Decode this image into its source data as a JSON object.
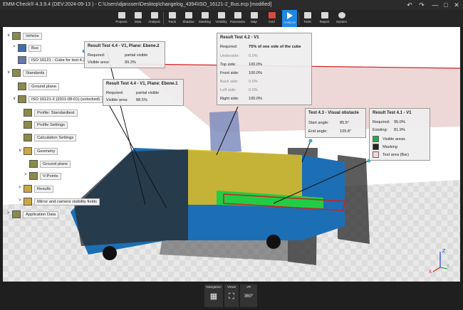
{
  "titlebar": {
    "title": "EMM-Check® 4.3.9.4 (DEV:2024-09-13 )  - C:\\Users\\djanssen\\Desktop\\changelog_4394\\ISO_16121-2_Bus.ecp [modified]",
    "undo_icon": "undo-icon",
    "redo_icon": "redo-icon",
    "minimize": "—",
    "maximize": "□",
    "close": "✕"
  },
  "ribbon": {
    "buttons": [
      {
        "label": "Projects",
        "icon": "projects-icon"
      },
      {
        "label": "Data",
        "icon": "data-icon"
      },
      {
        "label": "Analysis",
        "icon": "analysis-icon"
      },
      {
        "label": "Track",
        "icon": "track-icon"
      },
      {
        "label": "Shadow",
        "icon": "shadow-icon"
      },
      {
        "label": "Masking",
        "icon": "masking-icon"
      },
      {
        "label": "Visibility",
        "icon": "visibility-icon"
      },
      {
        "label": "Panorama",
        "icon": "panorama-icon"
      },
      {
        "label": "Map",
        "icon": "map-icon"
      },
      {
        "label": "Grid",
        "icon": "grid-icon"
      },
      {
        "label": "Analysis",
        "icon": "play-icon"
      },
      {
        "label": "Tools",
        "icon": "tools-icon"
      },
      {
        "label": "Report",
        "icon": "report-icon"
      },
      {
        "label": "System",
        "icon": "gear-icon"
      }
    ],
    "active_index": 10,
    "active_color": "#1e88e5"
  },
  "tree": {
    "nodes": [
      {
        "label": "Vehicle",
        "expander": "∨",
        "icon": "vehicle-icon"
      },
      {
        "label": "Bus",
        "expander": ">",
        "icon": "bus-icon"
      },
      {
        "label": "ISO 16121 - Cube for test 4.2",
        "expander": "",
        "icon": "cube-icon"
      },
      {
        "label": "Standards",
        "expander": "∨",
        "icon": "standards-icon"
      },
      {
        "label": "Ground plane",
        "expander": "",
        "icon": "ground-plane-icon"
      },
      {
        "label": "ISO 16121-2 (2011-08-01) (unlocked)",
        "expander": "∨",
        "icon": "standard-icon"
      },
      {
        "label": "Profile: Standardtest",
        "expander": "",
        "icon": "profile-icon"
      },
      {
        "label": "Profile Settings",
        "expander": "",
        "icon": "profile-settings-icon"
      },
      {
        "label": "Calculation Settings",
        "expander": "",
        "icon": "calculation-settings-icon"
      },
      {
        "label": "Geometry",
        "expander": "∨",
        "icon": "folder-icon"
      },
      {
        "label": "Ground plane",
        "expander": "",
        "icon": "ground-plane-icon"
      },
      {
        "label": "V-Points",
        "expander": ">",
        "icon": "v-points-icon"
      },
      {
        "label": "Results",
        "expander": ">",
        "icon": "folder-icon"
      },
      {
        "label": "Mirror and camera visibility fields",
        "expander": ">",
        "icon": "folder-icon"
      },
      {
        "label": "Application Data",
        "expander": ">",
        "icon": "application-data-icon"
      }
    ]
  },
  "popups": {
    "test44_ebene2": {
      "title": "Result Test 4.4 - V1, Plane: Ebene.2",
      "rows": [
        {
          "key": "Required:",
          "value": "partial visible"
        },
        {
          "key": "Visible area:",
          "value": "99.3%"
        }
      ]
    },
    "test44_ebene1": {
      "title": "Result Test 4.4 - V1, Plane: Ebene.1",
      "rows": [
        {
          "key": "Required:",
          "value": "partial visible"
        },
        {
          "key": "Visible area:",
          "value": "88.5%"
        }
      ]
    },
    "test42": {
      "title": "Result Test 4.2 - V1",
      "required_key": "Required:",
      "required_value": "75% of one side of the cube",
      "rows": [
        {
          "key": "Underside:",
          "value": "0.0%"
        },
        {
          "key": "Top side:",
          "value": "100.0%"
        },
        {
          "key": "Front side:",
          "value": "100.0%"
        },
        {
          "key": "Back side:",
          "value": "0.0%"
        },
        {
          "key": "Left side:",
          "value": "0.0%"
        },
        {
          "key": "Right side:",
          "value": "100.0%"
        }
      ]
    },
    "test43": {
      "title": "Test 4.3 - Visual obstacle",
      "rows": [
        {
          "key": "Start angle:",
          "value": "85.5°"
        },
        {
          "key": "End angle:",
          "value": "105.8°"
        }
      ]
    },
    "test41": {
      "title": "Result Test 4.1 - V1",
      "rows": [
        {
          "key": "Required:",
          "value": "95.0%"
        },
        {
          "key": "Existing:",
          "value": "81.9%"
        }
      ],
      "legend": [
        {
          "label": "Visible areas",
          "color": "#22aa44"
        },
        {
          "label": "Masking",
          "color": "#222222"
        },
        {
          "label": "Test area (Bar)",
          "color": "#f4d6d6"
        }
      ]
    }
  },
  "axes": {
    "z": "Z",
    "x": "X",
    "y": "Y"
  },
  "bottombar": {
    "navigation_label": "Navigation",
    "views_label": "Views",
    "vr_label": "VR",
    "vr_icon_text": "360°"
  },
  "colors": {
    "bus_blue": "#1c6fb4",
    "ground_red": "#cc2222",
    "visible_green": "#22cc44",
    "accent": "#1e88e5"
  }
}
